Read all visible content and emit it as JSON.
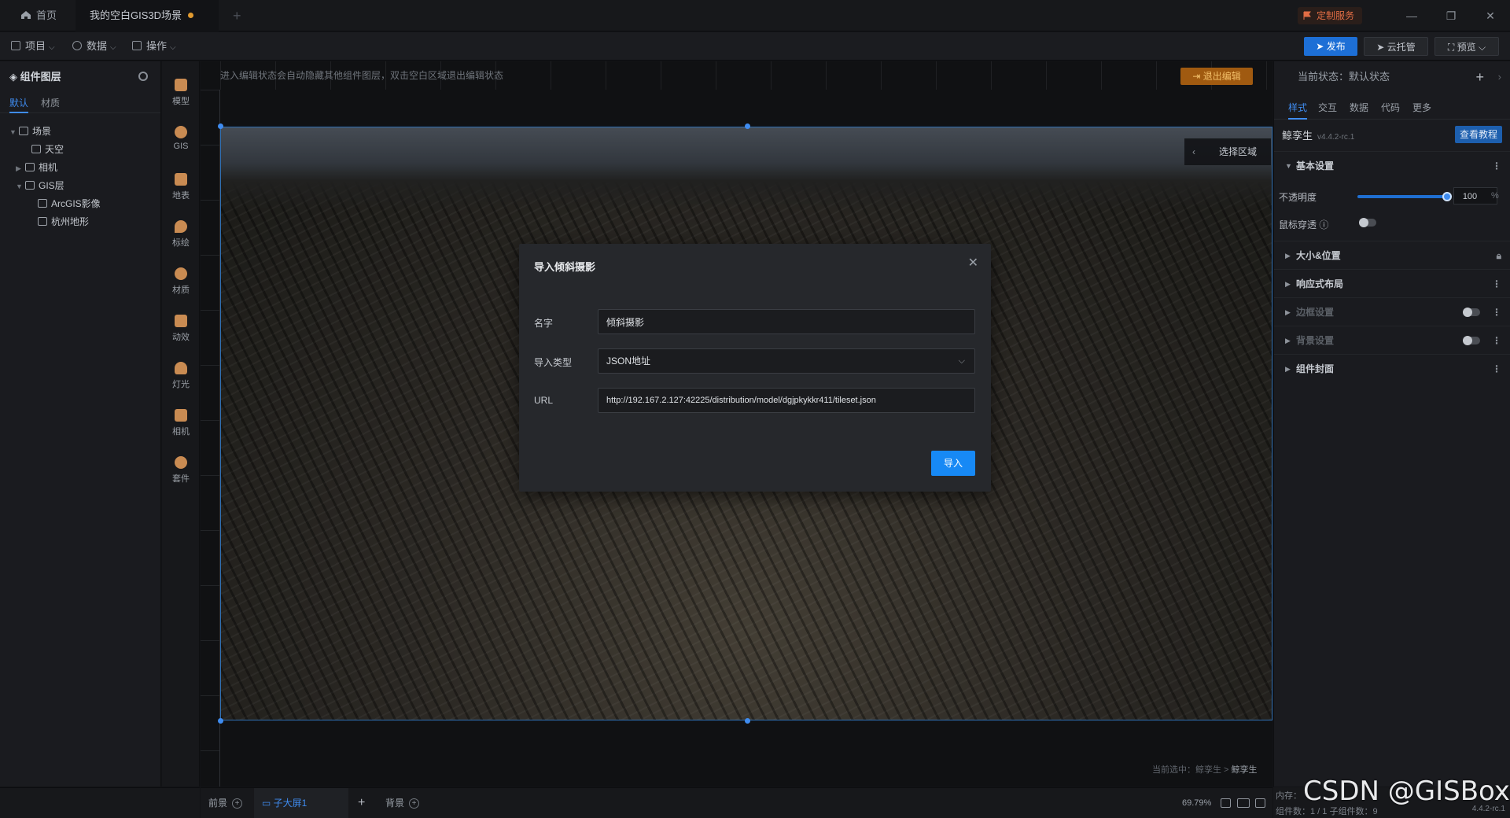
{
  "titlebar": {
    "home_tab": "首页",
    "scene_tab": "我的空白GIS3D场景",
    "add_tab": "+",
    "custom_service": "定制服务"
  },
  "menubar": {
    "project": "项目",
    "data": "数据",
    "operate": "操作",
    "publish": "发布",
    "cloud": "云托管",
    "preview": "预览"
  },
  "layers": {
    "title": "组件图层",
    "tabs": [
      "默认",
      "材质"
    ],
    "items": [
      {
        "label": "场景"
      },
      {
        "label": "天空"
      },
      {
        "label": "相机"
      },
      {
        "label": "GIS层"
      },
      {
        "label": "ArcGIS影像"
      },
      {
        "label": "杭州地形"
      }
    ]
  },
  "tools": [
    "模型",
    "GIS",
    "地表",
    "标绘",
    "材质",
    "动效",
    "灯光",
    "相机",
    "套件"
  ],
  "canvas": {
    "hint": "进入编辑状态会自动隐藏其他组件图层，双击空白区域退出编辑状态",
    "exit_edit": "退出编辑",
    "select_area": "选择区域",
    "current_select_prefix": "当前选中：鲸孪生 > ",
    "current_select_name": "鲸孪生"
  },
  "modal": {
    "title": "导入倾斜摄影",
    "name_label": "名字",
    "name_value": "倾斜摄影",
    "type_label": "导入类型",
    "type_value": "JSON地址",
    "url_label": "URL",
    "url_value": "http://192.167.2.127:42225/distribution/model/dgjpkykkr411/tileset.json",
    "import_button": "导入"
  },
  "right_panel": {
    "state_label": "当前状态：默认状态",
    "tabs": [
      "样式",
      "交互",
      "数据",
      "代码",
      "更多"
    ],
    "component_name": "鲸孪生",
    "component_version": "v4.4.2-rc.1",
    "tutorial_button": "查看教程",
    "sections": {
      "basic": "基本设置",
      "size_position": "大小&位置",
      "responsive": "响应式布局",
      "border": "边框设置",
      "background": "背景设置",
      "cover": "组件封面"
    },
    "opacity_label": "不透明度",
    "opacity_value": "100",
    "opacity_unit": "%",
    "opacity_fraction": 1.0,
    "mouse_through_label": "鼠标穿透"
  },
  "bottombar": {
    "foreground": "前景",
    "sub_screen": "子大屏1",
    "background": "背景",
    "zoom": "69.79%"
  },
  "status": {
    "memory": "内存：",
    "sub_count": "组件数：1 / 1   子组件数：9",
    "version": "4.4.2-rc.1"
  },
  "watermark": "CSDN @GISBox",
  "colors": {
    "accent": "#3f8cf0",
    "publish": "#1d6fd6",
    "import_button": "#1789f5",
    "exit_edit": "#a05a10",
    "custom_service": "#e26d45"
  }
}
